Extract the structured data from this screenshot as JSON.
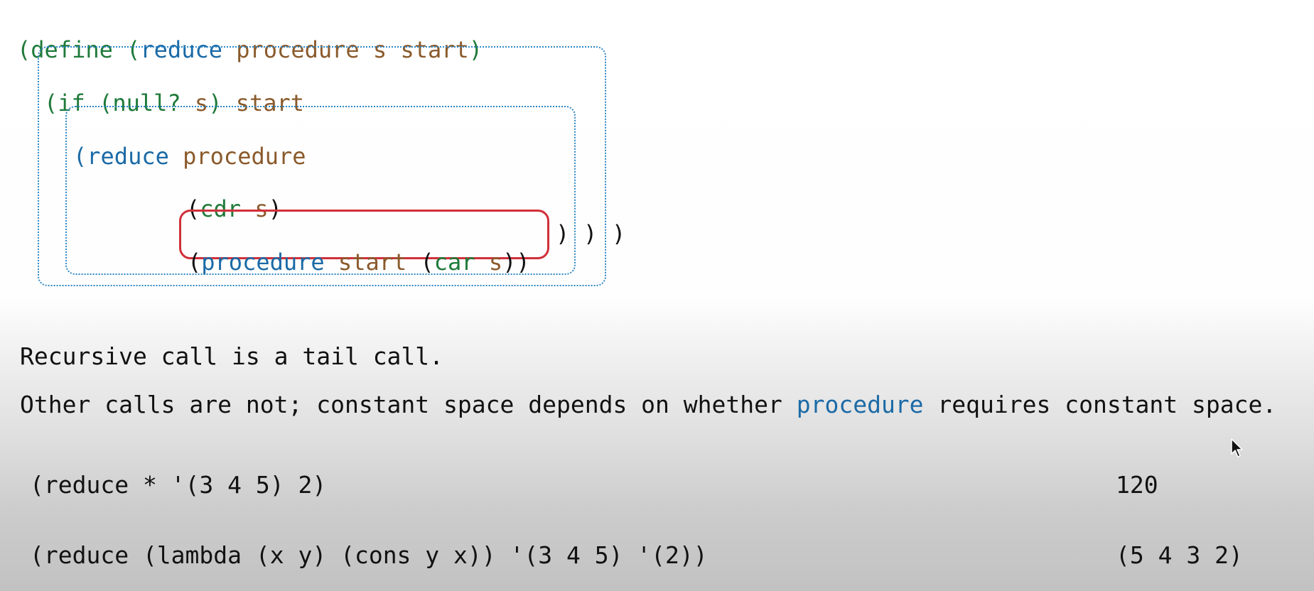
{
  "code": {
    "line1": {
      "open": "(",
      "define": "define",
      "sp1": " ",
      "open2": "(",
      "reduce": "reduce",
      "sp2": " ",
      "params": "procedure s start",
      "close": ")"
    },
    "line2": {
      "if_open": "(if",
      "sp": " ",
      "null_expr": "(null?",
      "s": " s",
      "close": ")",
      "start": " start"
    },
    "line3": {
      "open": "(",
      "reduce": "reduce",
      "procedure": " procedure"
    },
    "line4": {
      "open": "(",
      "cdr": "cdr",
      "s": " s",
      "close": ")"
    },
    "line5": {
      "open": "(",
      "procedure": "procedure",
      "start": " start",
      "sp": " ",
      "open2": "(",
      "car": "car",
      "s": " s",
      "close": "))",
      "closers": [
        ")",
        ")",
        ")"
      ]
    }
  },
  "notes": {
    "tail_call": "Recursive call is a tail call.",
    "other_prefix": "Other calls are not; constant space depends on whether ",
    "other_highlight": "procedure",
    "other_suffix": " requires constant space."
  },
  "examples": [
    {
      "expr": "(reduce * '(3 4 5) 2)",
      "result": "120"
    },
    {
      "expr": "(reduce (lambda (x y) (cons y x)) '(3 4 5) '(2))",
      "result": "(5 4 3 2)"
    }
  ],
  "colors": {
    "keyword": "#1f7a3a",
    "function": "#1b6aa6",
    "variable": "#8a5a2b",
    "box_border": "#2b86c5",
    "highlight_border": "#d0303a"
  },
  "icons": {
    "cursor": "mouse-pointer-icon"
  }
}
